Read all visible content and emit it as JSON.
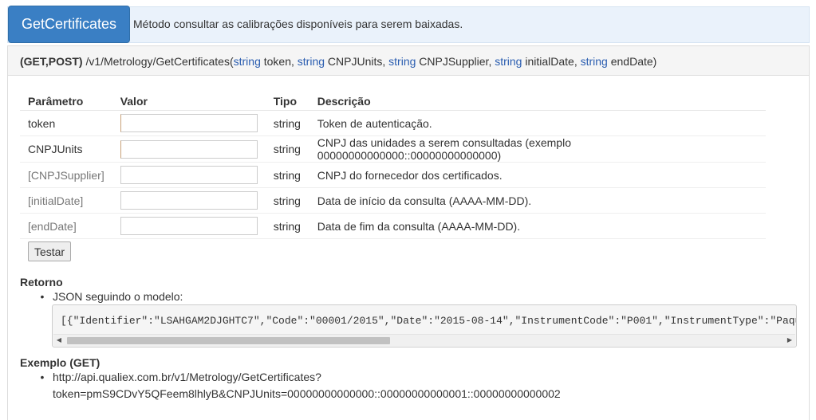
{
  "header": {
    "method_name": "GetCertificates",
    "method_description": "Método consultar as calibrações disponíveis para serem baixadas."
  },
  "signature": {
    "verbs": "(GET,POST)",
    "path": "/v1/Metrology/GetCertificates(",
    "params": [
      {
        "type": "string",
        "name": "token",
        "sep": ", "
      },
      {
        "type": "string",
        "name": "CNPJUnits",
        "sep": ", "
      },
      {
        "type": "string",
        "name": "CNPJSupplier",
        "sep": ", "
      },
      {
        "type": "string",
        "name": "initialDate",
        "sep": ", "
      },
      {
        "type": "string",
        "name": "endDate",
        "sep": ")"
      }
    ]
  },
  "table": {
    "headers": {
      "param": "Parâmetro",
      "value": "Valor",
      "type": "Tipo",
      "description": "Descrição"
    },
    "rows": [
      {
        "param": "token",
        "value": "",
        "type": "string",
        "description": "Token de autenticação."
      },
      {
        "param": "CNPJUnits",
        "value": "",
        "type": "string",
        "description": "CNPJ das unidades a serem consultadas (exemplo 00000000000000::00000000000000)"
      },
      {
        "param": "[CNPJSupplier]",
        "value": "",
        "type": "string",
        "description": "CNPJ do fornecedor dos certificados."
      },
      {
        "param": "[initialDate]",
        "value": "",
        "type": "string",
        "description": "Data de início da consulta (AAAA-MM-DD)."
      },
      {
        "param": "[endDate]",
        "value": "",
        "type": "string",
        "description": "Data de fim da consulta (AAAA-MM-DD)."
      }
    ]
  },
  "test_button": "Testar",
  "return": {
    "title": "Retorno",
    "bullet": "JSON seguindo o modelo:",
    "code": "[{\"Identifier\":\"LSAHGAM2DJGHTC7\",\"Code\":\"00001/2015\",\"Date\":\"2015-08-14\",\"InstrumentCode\":\"P001\",\"InstrumentType\":\"Paquímetro Dig"
  },
  "example": {
    "title": "Exemplo (GET)",
    "url_line1": "http://api.qualiex.com.br/v1/Metrology/GetCertificates?",
    "url_line2": "token=pmS9CDvY5QFeem8lhlyB&CNPJUnits=00000000000000::00000000000001::00000000000002"
  },
  "icons": {
    "bullet": "•",
    "scroll_left": "◀",
    "scroll_right": "▶"
  },
  "colors": {
    "method_button": "#3a7fc4",
    "type_keyword": "#2a5db0",
    "top_panel": "#eaf2fb"
  }
}
